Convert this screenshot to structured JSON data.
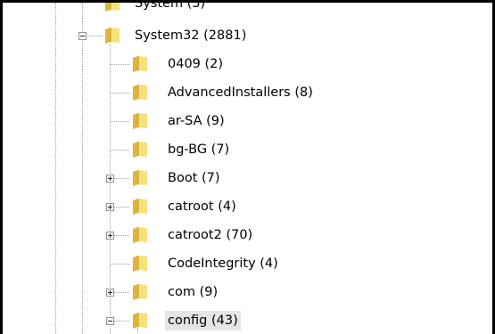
{
  "tree": {
    "partial_top": "System (5)",
    "parent": {
      "label": "System32 (2881)",
      "expanded": true
    },
    "children": [
      {
        "label": "0409 (2)",
        "expandable": false
      },
      {
        "label": "AdvancedInstallers (8)",
        "expandable": false
      },
      {
        "label": "ar-SA (9)",
        "expandable": false
      },
      {
        "label": "bg-BG (7)",
        "expandable": false
      },
      {
        "label": "Boot (7)",
        "expandable": true,
        "expanded": false
      },
      {
        "label": "catroot (4)",
        "expandable": true,
        "expanded": false
      },
      {
        "label": "catroot2 (70)",
        "expandable": true,
        "expanded": false
      },
      {
        "label": "CodeIntegrity (4)",
        "expandable": false
      },
      {
        "label": "com (9)",
        "expandable": true,
        "expanded": false
      },
      {
        "label": "config (43)",
        "expandable": true,
        "expanded": true,
        "selected": true
      }
    ]
  },
  "icons": {
    "folder": "folder-icon",
    "expand": "plus-expander-icon",
    "collapse": "minus-expander-icon"
  },
  "colors": {
    "selection": "#e5e5e5",
    "guide": "#a0a0a0",
    "folder_light": "#f8e07a",
    "folder_dark": "#e0b53a",
    "border": "#000000"
  }
}
